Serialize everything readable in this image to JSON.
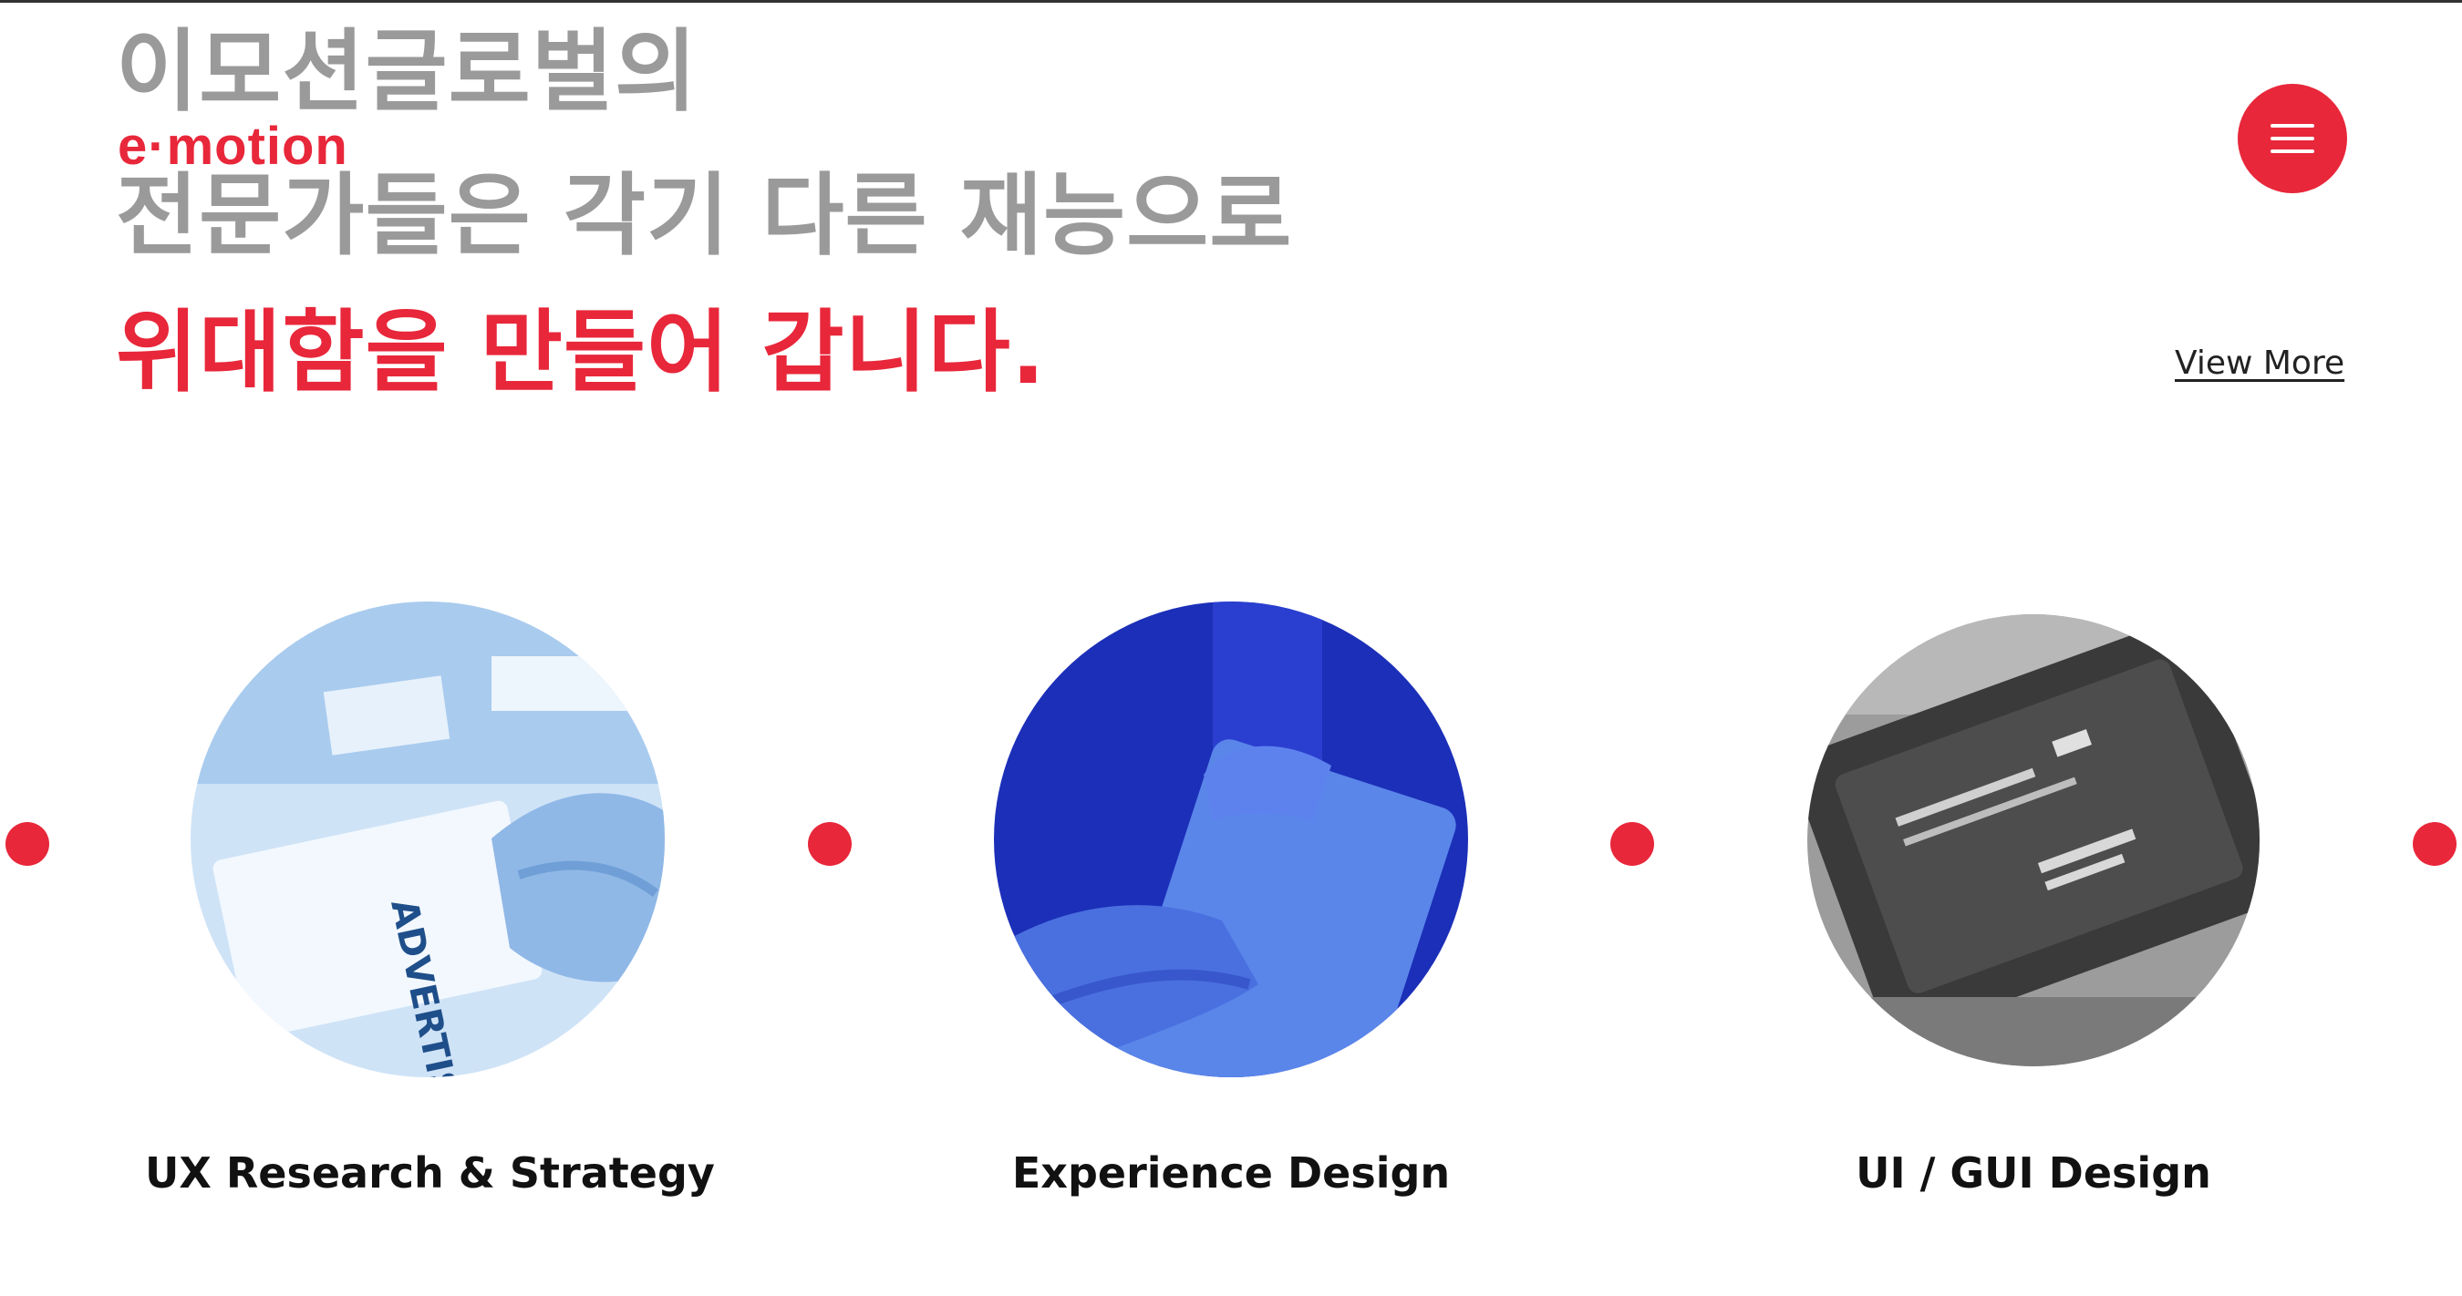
{
  "hero": {
    "line1": "이모션글로벌의",
    "logo": "e·motion",
    "line2": "전문가들은 각기 다른 재능으로",
    "line3": "위대함을 만들어 갑니다."
  },
  "header": {
    "menu_icon": "hamburger-menu-icon"
  },
  "links": {
    "view_more": "View More"
  },
  "services": [
    {
      "title": "UX Research & Strategy",
      "image": "advertising-card-photo",
      "tint": "#b9d7f5"
    },
    {
      "title": "Experience Design",
      "image": "hands-holding-tablet-photo",
      "tint": "#2b46d6"
    },
    {
      "title": "UI / GUI Design",
      "image": "smartphone-screen-photo",
      "tint": "#8a8a8a"
    }
  ],
  "colors": {
    "accent": "#e8273a",
    "heading_gray": "#9a9a9a",
    "text_dark": "#111111"
  }
}
